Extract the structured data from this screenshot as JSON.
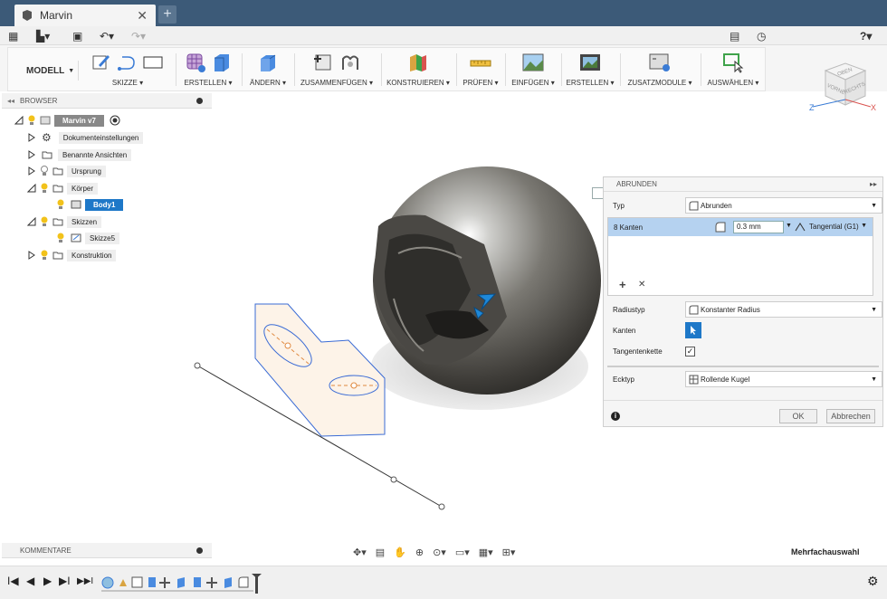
{
  "tab": {
    "title": "Marvin",
    "close": "✕",
    "new": "+"
  },
  "quickbar": {
    "grid": "▦",
    "file": "▙▾",
    "save": "▣",
    "undo": "↶▾",
    "redo": "↷▾",
    "chat": "▤",
    "clock": "◷",
    "help": "?▾"
  },
  "workspace": {
    "label": "MODELL"
  },
  "ribbon_groups": [
    {
      "label": "SKIZZE ▾"
    },
    {
      "label": "ERSTELLEN ▾"
    },
    {
      "label": "ÄNDERN ▾"
    },
    {
      "label": "ZUSAMMENFÜGEN ▾"
    },
    {
      "label": "KONSTRUIEREN ▾"
    },
    {
      "label": "PRÜFEN ▾"
    },
    {
      "label": "EINFÜGEN ▾"
    },
    {
      "label": "ERSTELLEN ▾"
    },
    {
      "label": "ZUSATZMODULE ▾"
    },
    {
      "label": "AUSWÄHLEN ▾"
    }
  ],
  "viewcube": {
    "top": "OBEN",
    "front": "VORNE",
    "right": "RECHTS",
    "axis_x": "X",
    "axis_z": "Z"
  },
  "browser": {
    "title": "BROWSER",
    "collapse": "◂◂",
    "items": [
      {
        "label": "Marvin v7"
      },
      {
        "label": "Dokumenteinstellungen"
      },
      {
        "label": "Benannte Ansichten"
      },
      {
        "label": "Ursprung"
      },
      {
        "label": "Körper"
      },
      {
        "label": "Body1"
      },
      {
        "label": "Skizzen"
      },
      {
        "label": "Skizze5"
      },
      {
        "label": "Konstruktion"
      }
    ]
  },
  "floating_input": {
    "value": "0.3 mm"
  },
  "dialog": {
    "title": "ABRUNDEN",
    "typ_label": "Typ",
    "typ_value": "Abrunden",
    "kanten_row": {
      "count": "8 Kanten",
      "radius": "0.3 mm",
      "continuity": "Tangential (G1)"
    },
    "add": "+",
    "remove": "✕",
    "radiustyp_label": "Radiustyp",
    "radiustyp_value": "Konstanter Radius",
    "kanten_label": "Kanten",
    "tangentenkette_label": "Tangentenkette",
    "ecktyp_label": "Ecktyp",
    "ecktyp_value": "Rollende Kugel",
    "info": "i",
    "ok": "OK",
    "cancel": "Abbrechen"
  },
  "comments": {
    "title": "KOMMENTARE"
  },
  "status": {
    "selection": "Mehrfachauswahl"
  },
  "timeline": {
    "first": "I◀",
    "prev": "◀",
    "play": "▶",
    "next": "▶I",
    "last": "▶▶I",
    "settings": "⚙"
  }
}
